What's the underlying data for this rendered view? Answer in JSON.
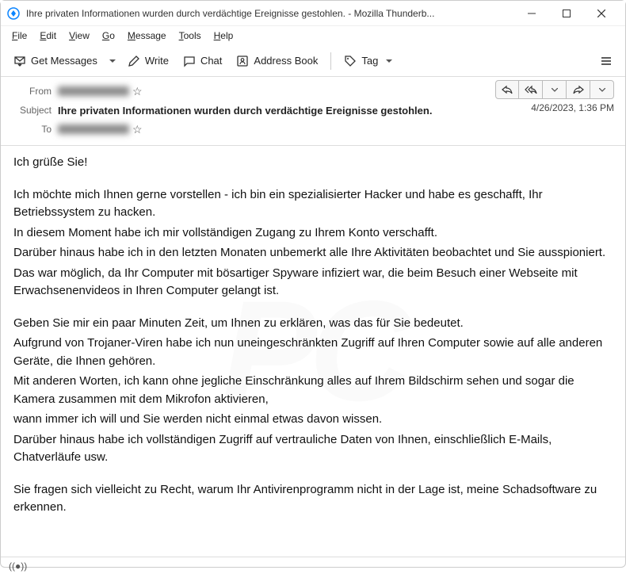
{
  "window": {
    "title": "Ihre privaten Informationen wurden durch verdächtige Ereignisse gestohlen. - Mozilla Thunderb..."
  },
  "menubar": {
    "file": "File",
    "edit": "Edit",
    "view": "View",
    "go": "Go",
    "message": "Message",
    "tools": "Tools",
    "help": "Help"
  },
  "toolbar": {
    "get_messages": "Get Messages",
    "write": "Write",
    "chat": "Chat",
    "address_book": "Address Book",
    "tag": "Tag"
  },
  "headers": {
    "from_label": "From",
    "subject_label": "Subject",
    "to_label": "To",
    "subject": "Ihre privaten Informationen wurden durch verdächtige Ereignisse gestohlen.",
    "datetime": "4/26/2023, 1:36 PM"
  },
  "body": {
    "p1": "Ich grüße Sie!",
    "p2": "Ich möchte mich Ihnen gerne vorstellen - ich bin ein spezialisierter Hacker und habe es geschafft, Ihr Betriebssystem zu hacken.",
    "p3": "In diesem Moment habe ich mir vollständigen Zugang zu Ihrem Konto verschafft.",
    "p4": "Darüber hinaus habe ich in den letzten Monaten unbemerkt alle Ihre Aktivitäten beobachtet und Sie ausspioniert.",
    "p5": "Das war möglich, da Ihr Computer mit bösartiger Spyware infiziert war, die beim Besuch einer Webseite mit Erwachsenenvideos in Ihren Computer gelangt ist.",
    "p6": "Geben Sie mir ein paar Minuten Zeit, um Ihnen zu erklären, was das für Sie bedeutet.",
    "p7": "Aufgrund von Trojaner-Viren habe ich nun uneingeschränkten Zugriff auf Ihren Computer sowie auf alle anderen Geräte, die Ihnen gehören.",
    "p8": "Mit anderen Worten, ich kann ohne jegliche Einschränkung alles auf Ihrem Bildschirm sehen und sogar die Kamera zusammen mit dem Mikrofon aktivieren,",
    "p9": "wann immer ich will und Sie werden nicht einmal etwas davon wissen.",
    "p10": "Darüber hinaus habe ich vollständigen Zugriff auf vertrauliche Daten von Ihnen, einschließlich E-Mails, Chatverläufe usw.",
    "p11": "Sie fragen sich vielleicht zu Recht, warum Ihr Antivirenprogramm nicht in der Lage ist, meine Schadsoftware zu erkennen."
  },
  "status": {
    "icon": "((●))"
  }
}
